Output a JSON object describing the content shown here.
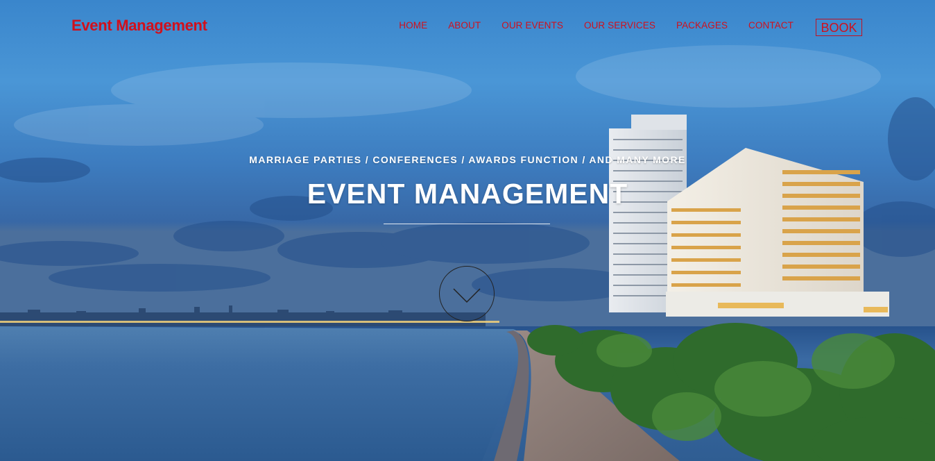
{
  "brand": {
    "name": "Event Management"
  },
  "nav": {
    "items": [
      {
        "label": "HOME"
      },
      {
        "label": "ABOUT"
      },
      {
        "label": "OUR EVENTS"
      },
      {
        "label": "OUR SERVICES"
      },
      {
        "label": "PACKAGES"
      },
      {
        "label": "CONTACT"
      }
    ],
    "book_label": "BOOK"
  },
  "hero": {
    "tagline": "MARRIAGE PARTIES / CONFERENCES / AWARDS FUNCTION / AND MANY MORE",
    "title": "EVENT MANAGEMENT",
    "scroll_icon": "chevron-down-icon"
  },
  "colors": {
    "accent": "#d0101c",
    "hero_text": "#ffffff"
  }
}
